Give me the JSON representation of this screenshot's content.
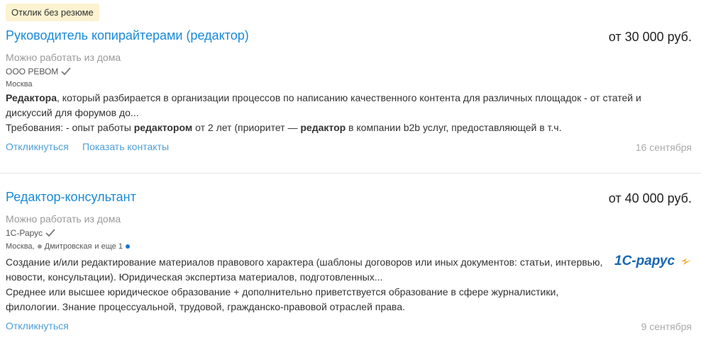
{
  "badge": "Отклик без резюме",
  "vacancies": [
    {
      "title": "Руководитель копирайтерами (редактор)",
      "salary": "от 30 000 руб.",
      "remote": "Можно работать из дома",
      "company": "ООО РЕВОМ",
      "city": "Москва",
      "desc1_parts": [
        "Редактора",
        ", который разбирается в организации процессов по написанию качественного контента для различных площадок - от статей и дискуссий для форумов до..."
      ],
      "desc2_parts": [
        "Требования: - опыт работы ",
        "редактором",
        " от 2 лет (приоритет — ",
        "редактор",
        " в компании b2b услуг, предоставляющей в т.ч."
      ],
      "action_respond": "Откликнуться",
      "action_contacts": "Показать контакты",
      "date": "16 сентября"
    },
    {
      "title": "Редактор-консультант",
      "salary": "от 40 000 руб.",
      "remote": "Можно работать из дома",
      "company": "1С-Рарус",
      "city": "Москва,",
      "metro": "Дмитровская",
      "metro_more": "и еще 1",
      "desc1": "Создание и/или редактирование материалов правового характера (шаблоны договоров или иных документов: статьи, интервью, новости, консультации). Юридическая экспертиза материалов, подготовленных...",
      "desc2": "Среднее или высшее юридическое образование + дополнительно приветствуется образование в сфере журналистики, филологии. Знание процессуальной, трудовой, гражданско-правовой отраслей права.",
      "action_respond": "Откликнуться",
      "date": "9 сентября",
      "logo_text": "1C-рарус"
    }
  ],
  "colors": {
    "link": "#1a8ad8",
    "action": "#4d9fd6",
    "metro_grey": "#999999",
    "metro_blue": "#1a75c9",
    "logo_blue": "#1967b3",
    "logo_orange": "#f5a623"
  },
  "icons": {
    "verified": "check-icon"
  }
}
